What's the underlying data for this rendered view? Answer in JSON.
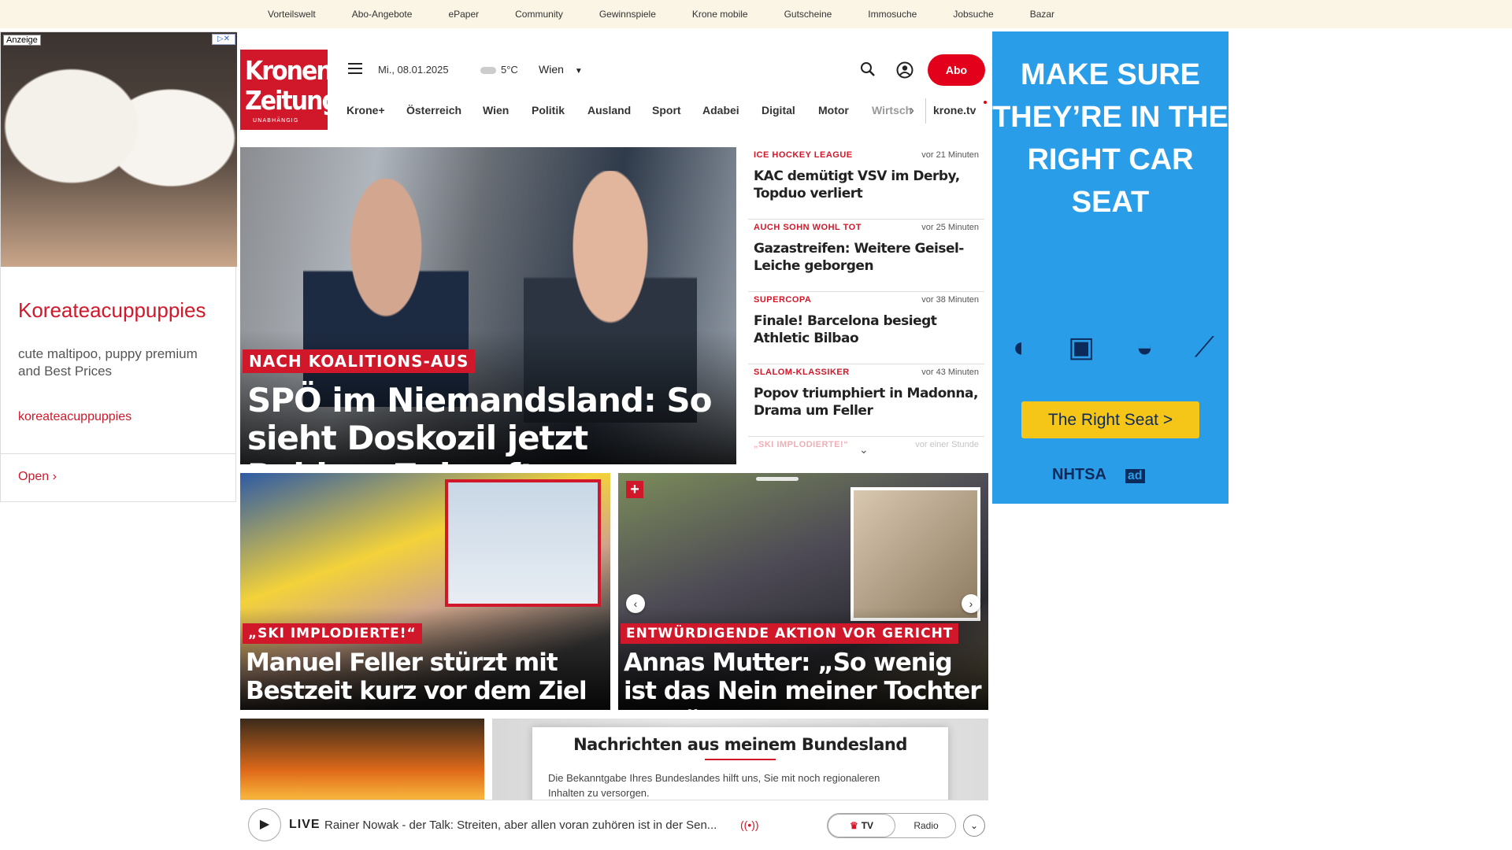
{
  "topbar": [
    "Vorteilswelt",
    "Abo-Angebote",
    "ePaper",
    "Community",
    "Gewinnspiele",
    "Krone mobile",
    "Gutscheine",
    "Immosuche",
    "Jobsuche",
    "Bazar"
  ],
  "left_ad": {
    "label": "Anzeige",
    "title": "Koreateacuppuppies",
    "description": "cute maltipoo, puppy premium and Best Prices",
    "link": "koreateacuppuppies",
    "open": "Open"
  },
  "header": {
    "logo_line1": "Kronen",
    "logo_line2": "Zeitung",
    "logo_tagline": "UNABHÄNGIG",
    "date": "Mi., 08.01.2025",
    "temperature": "5°C",
    "city": "Wien",
    "abo": "Abo"
  },
  "nav": [
    "Krone+",
    "Österreich",
    "Wien",
    "Politik",
    "Ausland",
    "Sport",
    "Adabei",
    "Digital",
    "Motor",
    "Wirtsch"
  ],
  "nav_tv": "krone.tv",
  "hero": {
    "kicker": "NACH KOALITIONS-AUS",
    "headline": "SPÖ im Niemandsland: So sieht Doskozil jetzt Bablers Zukunft"
  },
  "ticker": [
    {
      "category": "ICE HOCKEY LEAGUE",
      "time": "vor 21 Minuten",
      "title": "KAC demütigt VSV im Derby, Topduo verliert"
    },
    {
      "category": "AUCH SOHN WOHL TOT",
      "time": "vor 25 Minuten",
      "title": "Gazastreifen: Weitere Geisel-Leiche geborgen"
    },
    {
      "category": "SUPERCOPA",
      "time": "vor 38 Minuten",
      "title": "Finale! Barcelona besiegt Athletic Bilbao"
    },
    {
      "category": "SLALOM-KLASSIKER",
      "time": "vor 43 Minuten",
      "title": "Popov triumphiert in Madonna, Drama um Feller"
    },
    {
      "category": "„SKI IMPLODIERTE!“",
      "time": "vor einer Stunde",
      "title": ""
    }
  ],
  "right_ad": {
    "headline": "MAKE SURE THEY’RE IN THE RIGHT CAR SEAT",
    "button": "The Right Seat >",
    "logo1": "NHTSA",
    "logo2": "ad"
  },
  "cards": [
    {
      "kicker": "„SKI IMPLODIERTE!“",
      "headline": "Manuel Feller stürzt mit Bestzeit kurz vor dem Ziel"
    },
    {
      "kicker": "ENTWÜRDIGENDE AKTION VOR GERICHT",
      "headline": "Annas Mutter: „So wenig ist das Nein meiner Tochter wert“"
    }
  ],
  "popup": {
    "title": "Nachrichten aus meinem Bundesland",
    "text": "Die Bekanntgabe Ihres Bundeslandes hilft uns, Sie mit noch regionaleren Inhalten zu versorgen."
  },
  "live": {
    "label": "LIVE",
    "text": "Rainer Nowak - der Talk: Streiten, aber allen voran zuhören ist in der Sen...",
    "tv": "TV",
    "radio": "Radio"
  }
}
